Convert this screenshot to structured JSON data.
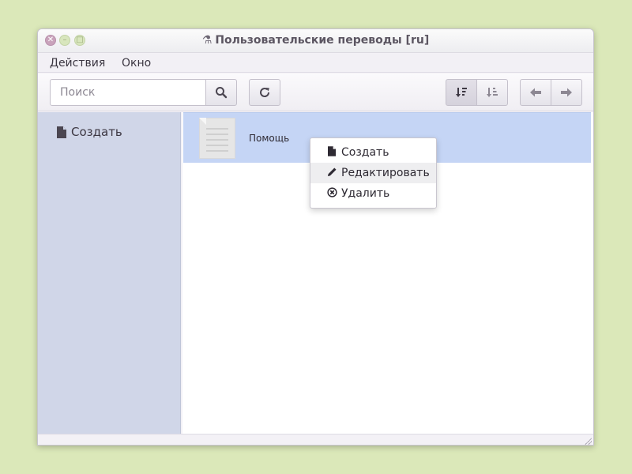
{
  "window": {
    "title": "Пользовательские переводы [ru]",
    "title_icon": "flask-icon",
    "controls": {
      "close": "close-icon",
      "minimize": "minimize-icon",
      "maximize": "maximize-icon"
    }
  },
  "menubar": {
    "items": [
      {
        "label": "Действия"
      },
      {
        "label": "Окно"
      }
    ]
  },
  "toolbar": {
    "search_placeholder": "Поиск",
    "search_value": "",
    "buttons": {
      "search": "search-icon",
      "refresh": "refresh-icon",
      "sort_desc": "sort-descending-icon",
      "sort_asc": "sort-ascending-icon",
      "back": "arrow-left-icon",
      "forward": "arrow-right-icon"
    }
  },
  "sidebar": {
    "items": [
      {
        "label": "Создать",
        "icon": "file-icon"
      }
    ]
  },
  "list": {
    "items": [
      {
        "label": "Помощь",
        "icon": "document-icon",
        "selected": true
      }
    ]
  },
  "context_menu": {
    "items": [
      {
        "label": "Создать",
        "icon": "file-icon"
      },
      {
        "label": "Редактировать",
        "icon": "pencil-icon",
        "hovered": true
      },
      {
        "label": "Удалить",
        "icon": "delete-circle-icon"
      }
    ]
  },
  "colors": {
    "desktop": "#dbe8b9",
    "sidebar": "#d0d6e8",
    "selection": "#c5d5f5"
  }
}
